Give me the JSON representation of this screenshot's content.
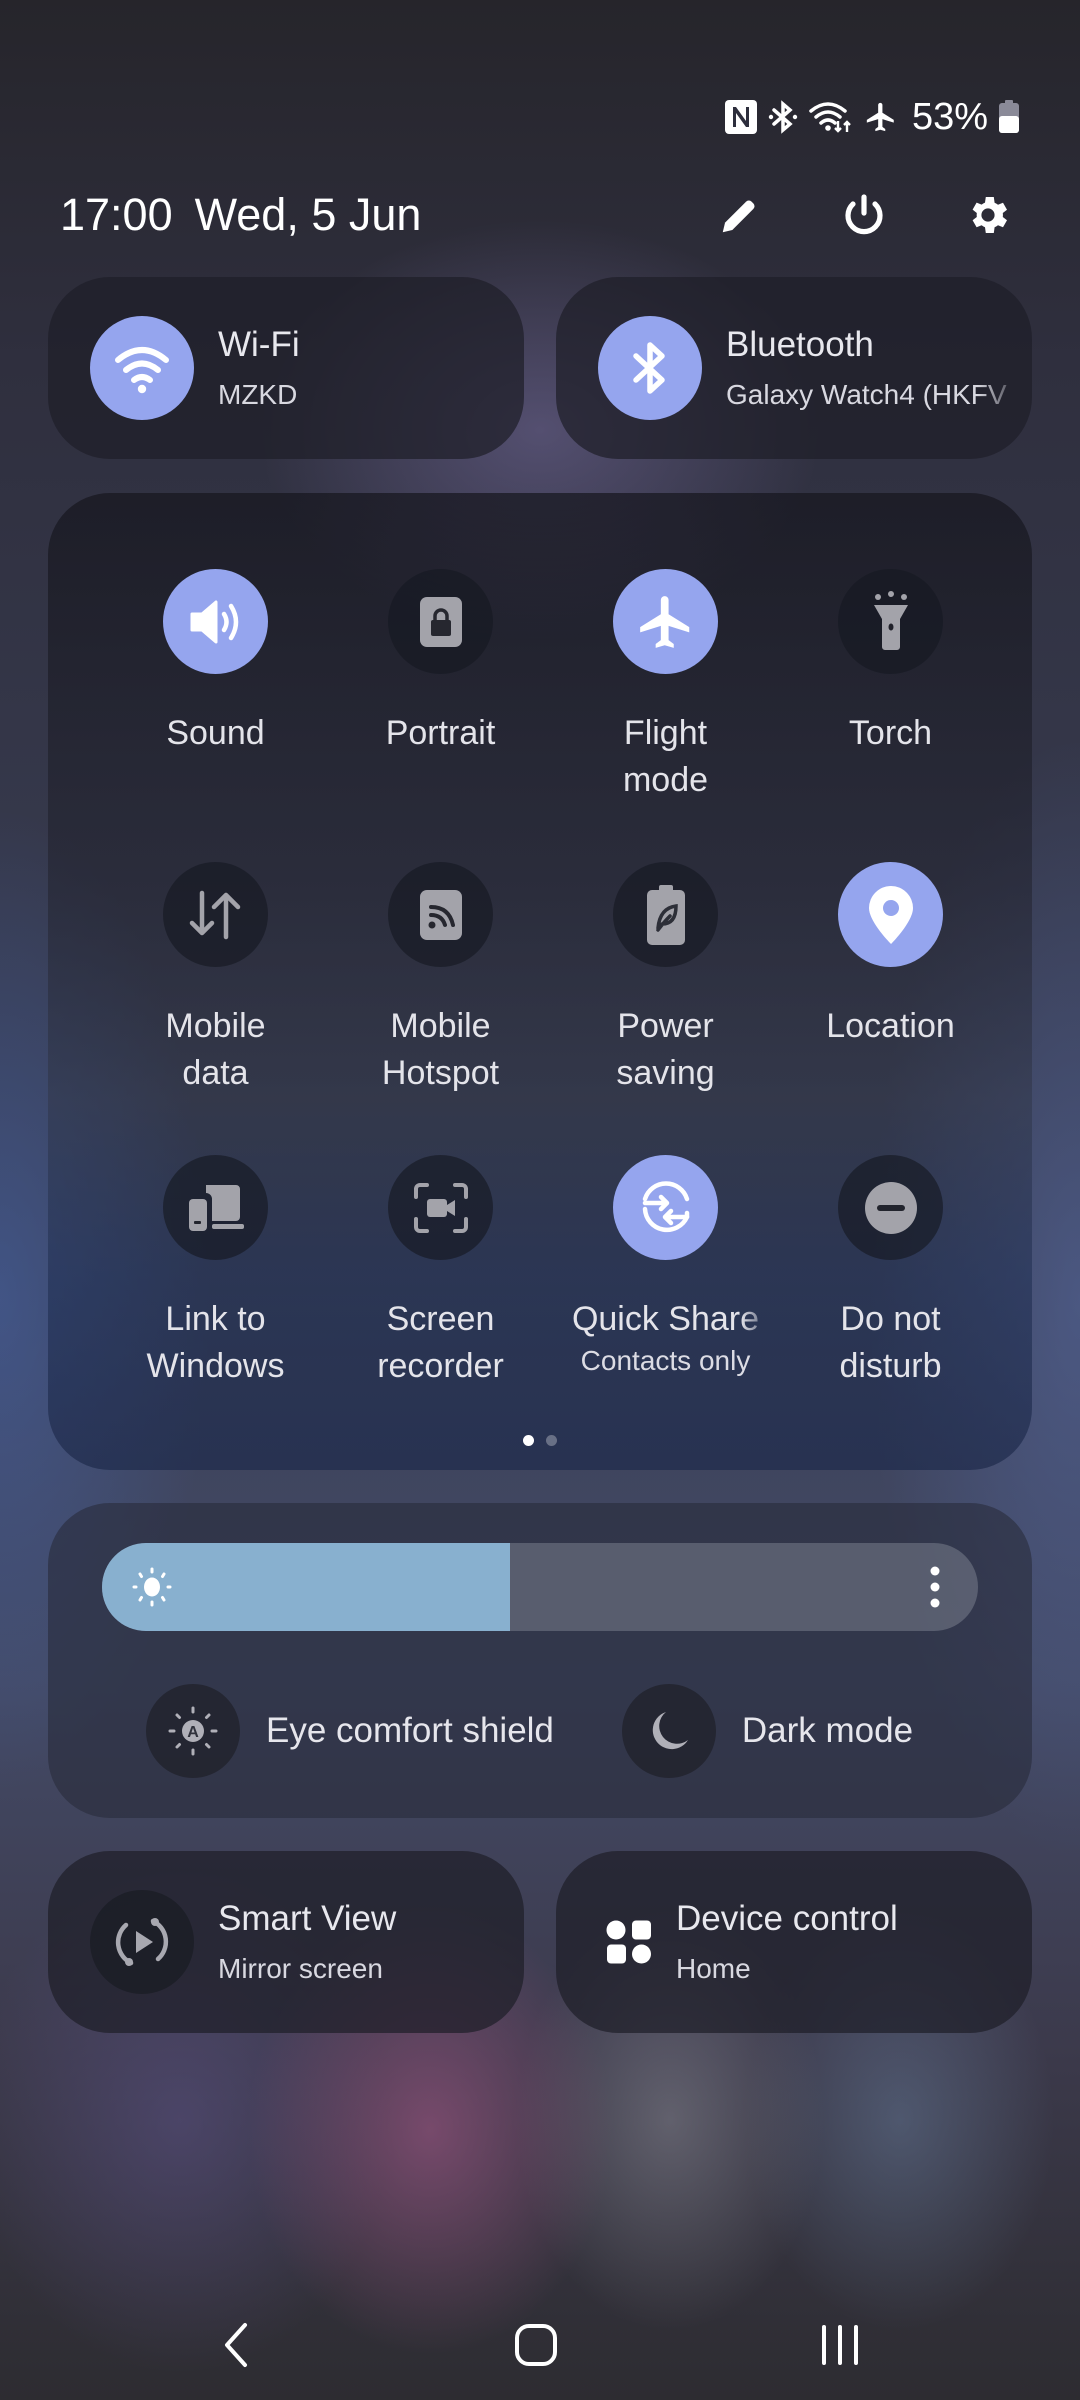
{
  "status_bar": {
    "icons": [
      "nfc-icon",
      "bluetooth-icon",
      "wifi-data-icon",
      "airplane-icon"
    ],
    "battery_percent": "53%",
    "battery_level": 0.53
  },
  "header": {
    "time": "17:00",
    "date": "Wed, 5 Jun",
    "edit_icon": "pencil-icon",
    "power_icon": "power-icon",
    "settings_icon": "gear-icon"
  },
  "connectivity": {
    "wifi": {
      "title": "Wi-Fi",
      "subtitle": "MZKD",
      "on": true
    },
    "bluetooth": {
      "title": "Bluetooth",
      "subtitle": "Galaxy Watch4 (HKFV",
      "on": true
    }
  },
  "quick_tiles": [
    {
      "label": "Sound",
      "sub": "",
      "on": true,
      "icon": "speaker-icon"
    },
    {
      "label": "Portrait",
      "sub": "",
      "on": false,
      "icon": "portrait-lock-icon"
    },
    {
      "label": "Flight\nmode",
      "sub": "",
      "on": true,
      "icon": "airplane-icon"
    },
    {
      "label": "Torch",
      "sub": "",
      "on": false,
      "icon": "torch-icon"
    },
    {
      "label": "Mobile\ndata",
      "sub": "",
      "on": false,
      "icon": "mobile-data-icon"
    },
    {
      "label": "Mobile\nHotspot",
      "sub": "",
      "on": false,
      "icon": "hotspot-icon"
    },
    {
      "label": "Power\nsaving",
      "sub": "",
      "on": false,
      "icon": "power-saving-icon"
    },
    {
      "label": "Location",
      "sub": "",
      "on": true,
      "icon": "location-pin-icon"
    },
    {
      "label": "Link to\nWindows",
      "sub": "",
      "on": false,
      "icon": "link-to-windows-icon"
    },
    {
      "label": "Screen\nrecorder",
      "sub": "",
      "on": false,
      "icon": "screen-recorder-icon"
    },
    {
      "label": "Quick Share",
      "sub": "Contacts only",
      "on": true,
      "icon": "quick-share-icon"
    },
    {
      "label": "Do not\ndisturb",
      "sub": "",
      "on": false,
      "icon": "do-not-disturb-icon"
    }
  ],
  "pager": {
    "pages": 2,
    "current": 1
  },
  "brightness": {
    "level": 0.466,
    "sun_icon": "sun-icon",
    "more_icon": "more-vertical-icon",
    "eye_comfort_label": "Eye comfort shield",
    "dark_mode_label": "Dark mode"
  },
  "bottom_pills": {
    "smart_view": {
      "title": "Smart View",
      "subtitle": "Mirror screen"
    },
    "device_control": {
      "title": "Device control",
      "subtitle": "Home"
    }
  },
  "nav": {
    "back": "back-icon",
    "home": "home-icon",
    "recents": "recents-icon"
  },
  "colors": {
    "accent": "#95a5ee",
    "slider_fill": "#88b0cf"
  }
}
